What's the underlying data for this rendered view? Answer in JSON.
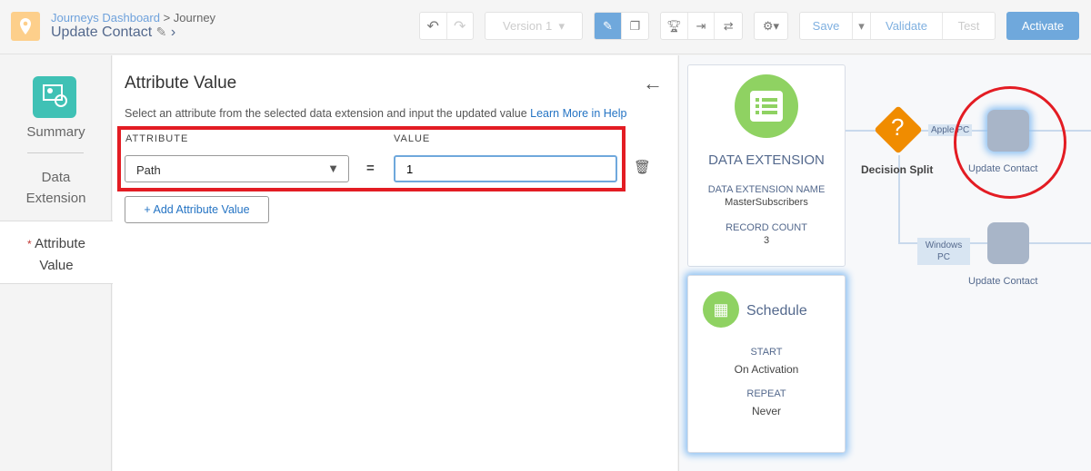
{
  "header": {
    "breadcrumb_link": "Journeys Dashboard",
    "breadcrumb_sep": " > ",
    "breadcrumb_current": "Journey",
    "title": "Update Contact",
    "version": "Version 1",
    "save": "Save",
    "validate": "Validate",
    "test": "Test",
    "activate": "Activate"
  },
  "sidebar": {
    "items": [
      {
        "label": "Summary"
      },
      {
        "label": "Data Extension"
      },
      {
        "label": "Attribute Value",
        "required": "*"
      }
    ]
  },
  "panel": {
    "title": "Attribute Value",
    "description": "Select an attribute from the selected data extension and input the updated value",
    "help_link": "Learn More in Help",
    "attribute_header": "ATTRIBUTE",
    "value_header": "VALUE",
    "attribute_value": "Path",
    "equals": "=",
    "value": "1",
    "add_button": "+ Add Attribute Value"
  },
  "canvas": {
    "data_extension": {
      "title": "DATA EXTENSION",
      "name_label": "DATA EXTENSION NAME",
      "name": "MasterSubscribers",
      "count_label": "RECORD COUNT",
      "count": "3"
    },
    "schedule": {
      "title": "Schedule",
      "start_label": "START",
      "start": "On Activation",
      "repeat_label": "REPEAT",
      "repeat": "Never"
    },
    "decision": "Decision Split",
    "path1": "Apple PC",
    "path2": "Windows PC",
    "activity1": "Update Contact",
    "activity2": "Update Contact"
  },
  "colors": {
    "accent": "#6fa8dc",
    "decision": "#f08c00",
    "green": "#8fd262",
    "teal": "#3fc1b5",
    "highlight": "#e31c23"
  }
}
